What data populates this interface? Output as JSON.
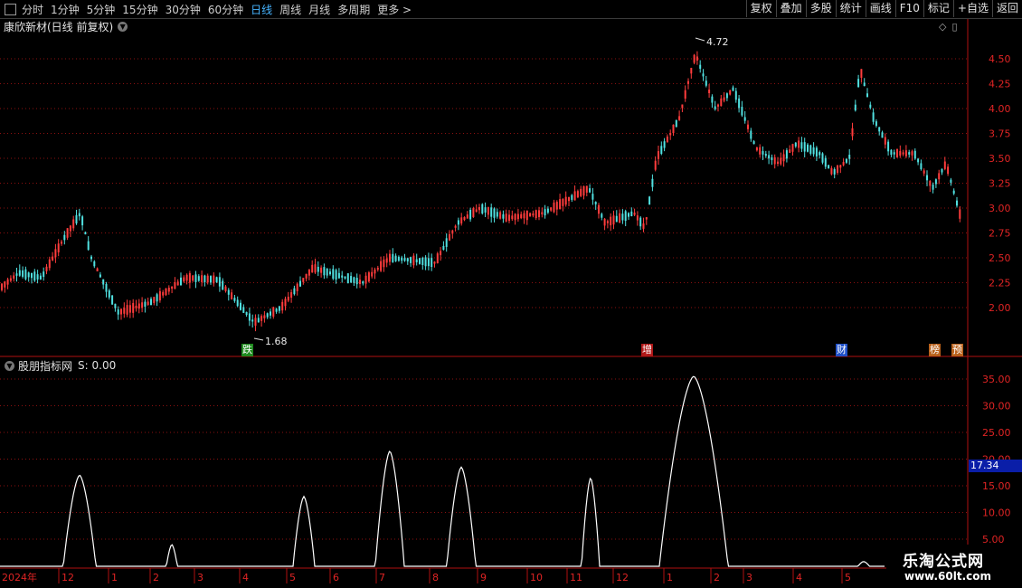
{
  "toolbar": {
    "tabs": [
      {
        "label": "分时",
        "active": false
      },
      {
        "label": "1分钟",
        "active": false
      },
      {
        "label": "5分钟",
        "active": false
      },
      {
        "label": "15分钟",
        "active": false
      },
      {
        "label": "30分钟",
        "active": false
      },
      {
        "label": "60分钟",
        "active": false
      },
      {
        "label": "日线",
        "active": true
      },
      {
        "label": "周线",
        "active": false
      },
      {
        "label": "月线",
        "active": false
      },
      {
        "label": "多周期",
        "active": false
      },
      {
        "label": "更多 >",
        "active": false
      }
    ],
    "buttons": [
      "复权",
      "叠加",
      "多股",
      "统计",
      "画线",
      "F10",
      "标记",
      "+自选",
      "返回"
    ]
  },
  "main_chart": {
    "title": "康欣新材(日线 前复权)",
    "price_ticks": [
      "4.50",
      "4.25",
      "4.00",
      "3.75",
      "3.50",
      "3.25",
      "3.00",
      "2.75",
      "2.50",
      "2.25",
      "2.00"
    ],
    "price_values": [
      4.5,
      4.25,
      4.0,
      3.75,
      3.5,
      3.25,
      3.0,
      2.75,
      2.5,
      2.25,
      2.0
    ],
    "high_label": "4.72",
    "low_label": "1.68",
    "markers": [
      {
        "text": "跌",
        "bg": "#1f8a1f"
      },
      {
        "text": "增",
        "bg": "#b01818"
      },
      {
        "text": "财",
        "bg": "#2050c8"
      },
      {
        "text": "榜",
        "bg": "#b8601a"
      },
      {
        "text": "预",
        "bg": "#b8601a"
      }
    ]
  },
  "indicator": {
    "name": "股朋指标网",
    "value_label": "S: 0.00",
    "ticks": [
      "35.00",
      "30.00",
      "25.00",
      "20.00",
      "15.00",
      "10.00",
      "5.00"
    ],
    "tick_values": [
      35,
      30,
      25,
      20,
      15,
      10,
      5
    ],
    "current_value": "17.34"
  },
  "time_axis": [
    "2024年",
    "12",
    "1",
    "2",
    "3",
    "4",
    "5",
    "6",
    "7",
    "8",
    "9",
    "10",
    "11",
    "12",
    "1",
    "2",
    "3",
    "4",
    "5"
  ],
  "watermark": {
    "title": "乐淘公式网",
    "url": "www.60lt.com"
  },
  "colors": {
    "up": "#ff3c3c",
    "down": "#50e0e0",
    "grid": "#8b1010",
    "axis_text": "#e02424",
    "active_tab": "#46b4ff"
  }
}
